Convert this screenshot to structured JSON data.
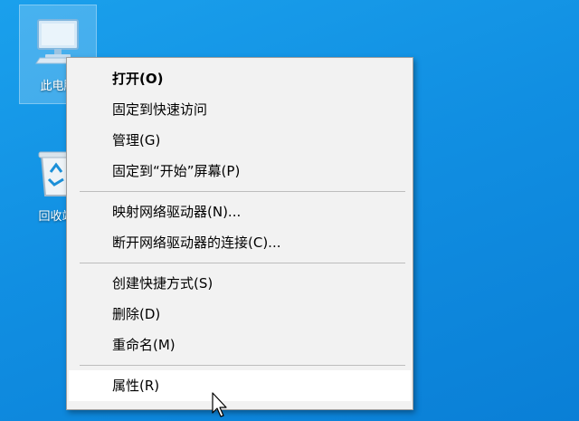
{
  "desktop": {
    "icons": [
      {
        "label": "此电脑"
      },
      {
        "label": "回收站"
      }
    ]
  },
  "context_menu": {
    "items": [
      {
        "label": "打开(O)"
      },
      {
        "label": "固定到快速访问"
      },
      {
        "label": "管理(G)"
      },
      {
        "label": "固定到“开始”屏幕(P)"
      },
      {
        "label": "映射网络驱动器(N)..."
      },
      {
        "label": "断开网络驱动器的连接(C)..."
      },
      {
        "label": "创建快捷方式(S)"
      },
      {
        "label": "删除(D)"
      },
      {
        "label": "重命名(M)"
      },
      {
        "label": "属性(R)"
      }
    ]
  },
  "colors": {
    "desktop_background": "#118fe2",
    "menu_background": "#f2f2f2",
    "menu_hover": "#ffffff"
  },
  "icons": {
    "this_pc": "computer-icon",
    "recycle_bin": "recycle-bin-icon",
    "cursor": "arrow-cursor-icon"
  }
}
